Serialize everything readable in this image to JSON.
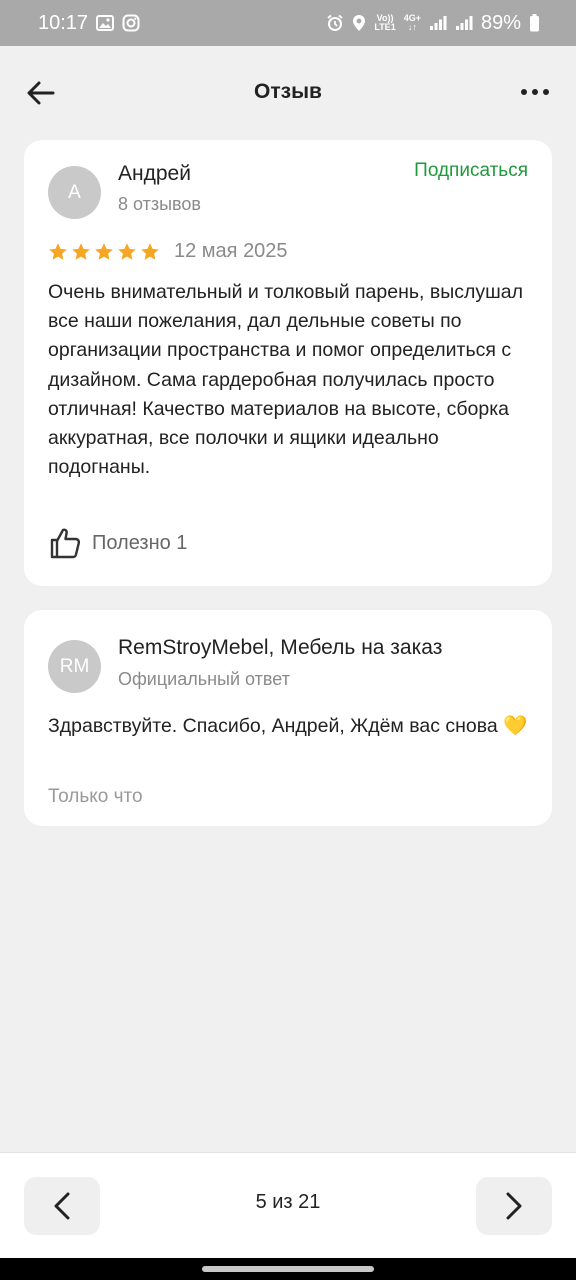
{
  "status_bar": {
    "time": "10:17",
    "battery": "89%",
    "volte_top": "Vo))",
    "volte_bottom": "LTE1",
    "network": "4G+"
  },
  "app_bar": {
    "title": "Отзыв"
  },
  "review": {
    "avatar_letter": "А",
    "author": "Андрей",
    "reviews_count": "8 отзывов",
    "subscribe_label": "Подписаться",
    "rating": 5,
    "date": "12 мая 2025",
    "text": "Очень внимательный и толковый парень, выслушал все наши пожелания, дал дельные советы по организации пространства и помог определиться с дизайном. Сама гардеробная получилась просто отличная! Качество материалов на высоте, сборка аккуратная, все полочки и ящики идеально подогнаны.",
    "useful_label": "Полезно 1"
  },
  "reply": {
    "avatar_letters": "RM",
    "company": "RemStroyMebel, Мебель на заказ",
    "badge": "Официальный ответ",
    "text": "Здравствуйте. Спасибо, Андрей, Ждём вас снова 💛",
    "time": "Только что"
  },
  "pagination": {
    "label": "5 из 21"
  },
  "colors": {
    "accent_green": "#1f9a3c",
    "star_gold": "#f5a623",
    "background": "#f0f0f0"
  }
}
